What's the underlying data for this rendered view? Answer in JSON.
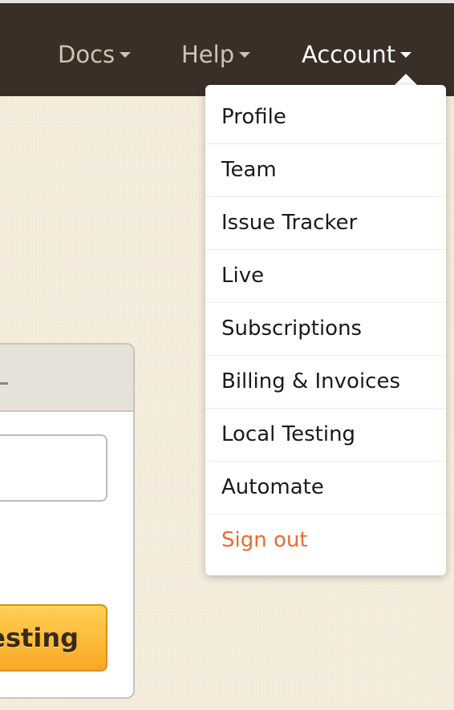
{
  "nav": {
    "docs": "Docs",
    "help": "Help",
    "account": "Account"
  },
  "account_menu": {
    "items": [
      {
        "label": "Profile"
      },
      {
        "label": "Team"
      },
      {
        "label": "Issue Tracker"
      },
      {
        "label": "Live"
      },
      {
        "label": "Subscriptions"
      },
      {
        "label": "Billing & Invoices"
      },
      {
        "label": "Local Testing"
      },
      {
        "label": "Automate"
      },
      {
        "label": "Sign out"
      }
    ]
  },
  "card": {
    "button_label": "Testing"
  },
  "colors": {
    "topbar": "#3a2f27",
    "signout": "#ec6a34",
    "button": "#f9a825"
  }
}
